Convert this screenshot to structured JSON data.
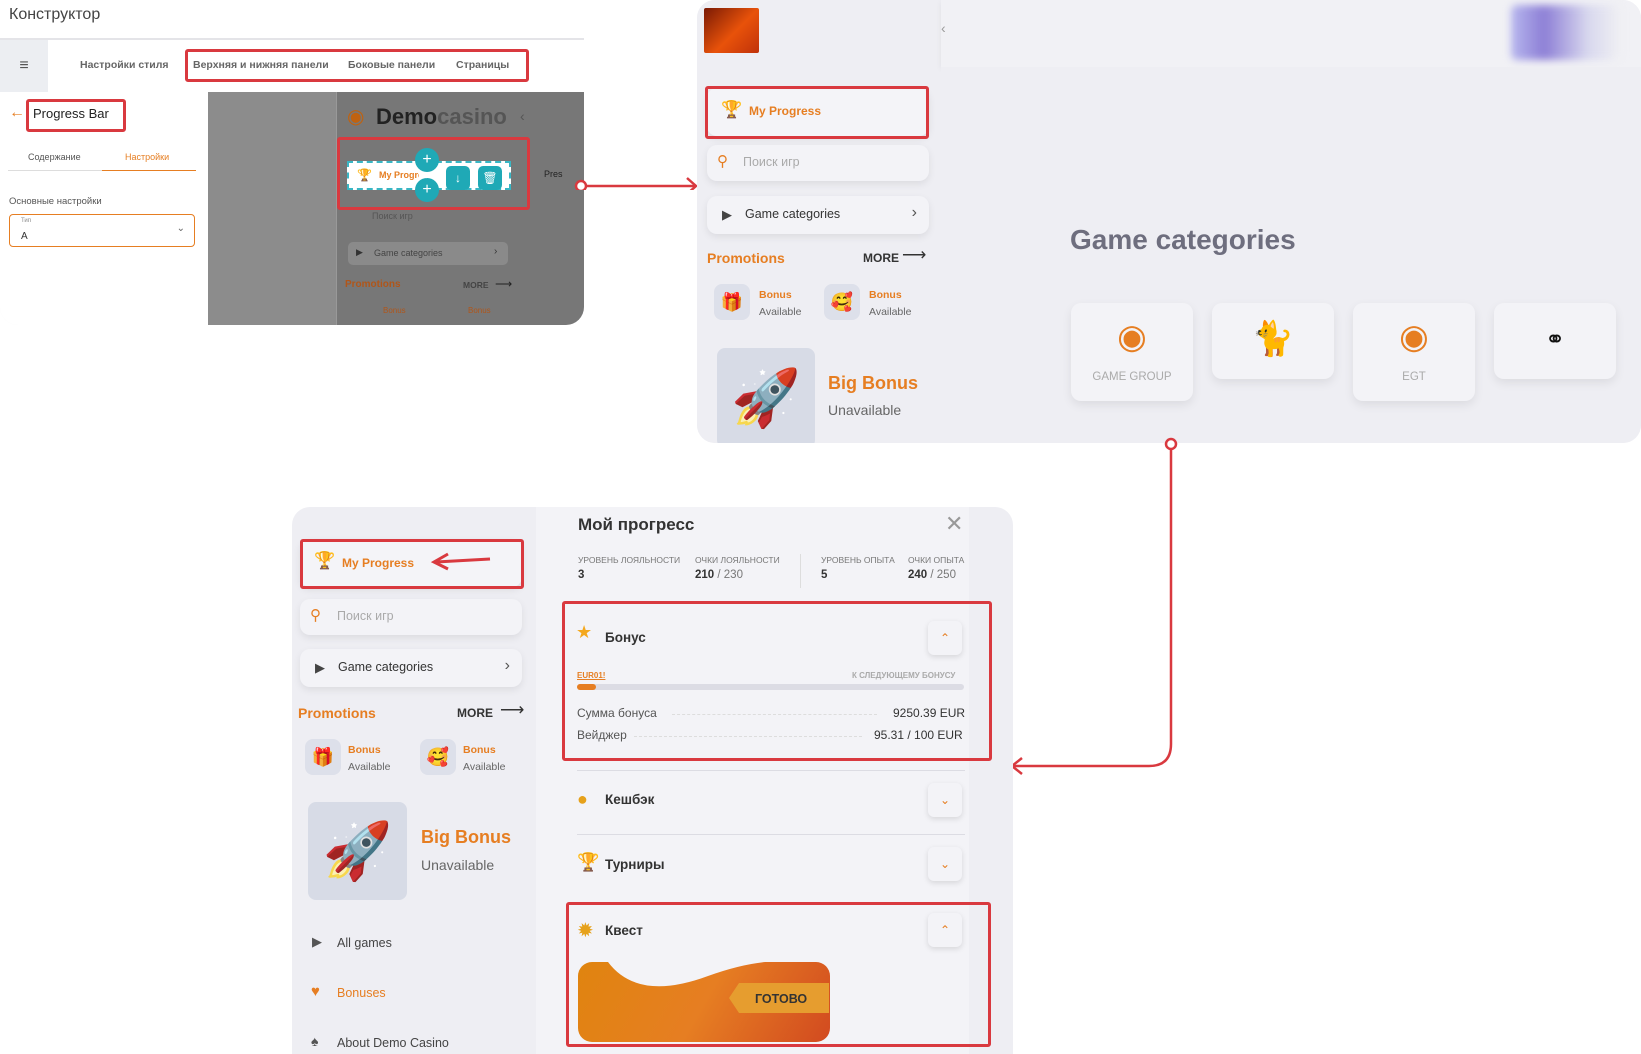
{
  "panel1": {
    "app_title": "Конструктор",
    "menu_icon": "menu-icon",
    "tabs": [
      "Настройки стиля",
      "Верхняя и нижняя панели",
      "Боковые панели",
      "Страницы"
    ],
    "section_title": "Progress Bar",
    "subtabs": [
      "Содержание",
      "Настройки"
    ],
    "settings_label": "Основные настройки",
    "type_label": "Тип",
    "type_value": "A",
    "preview": {
      "logo_demo": "Demo",
      "logo_casino": "casino",
      "my_progress": "My Progress",
      "search": "Поиск игр",
      "game_categories": "Game categories",
      "promotions": "Promotions",
      "more": "MORE",
      "bonus": "Bonus",
      "broken_img": "Pres"
    }
  },
  "panel2": {
    "my_progress": "My Progress",
    "search_placeholder": "Поиск игр",
    "game_categories": "Game categories",
    "promotions": "Promotions",
    "more": "MORE",
    "bonus_title": "Bonus",
    "bonus_status": "Available",
    "big_bonus": "Big Bonus",
    "big_bonus_status": "Unavailable",
    "heading": "Game categories",
    "provider_cards": [
      "GAME GROUP",
      "",
      "EGT",
      ""
    ]
  },
  "panel3": {
    "my_progress": "My Progress",
    "search_placeholder": "Поиск игр",
    "game_categories": "Game categories",
    "promotions": "Promotions",
    "more": "MORE",
    "bonus_title": "Bonus",
    "bonus_status": "Available",
    "big_bonus": "Big Bonus",
    "big_bonus_status": "Unavailable",
    "nav": [
      "All games",
      "Bonuses",
      "About Demo Casino"
    ],
    "modal": {
      "title": "Мой прогресс",
      "stats": [
        {
          "label": "Уровень лояльности",
          "value": "3",
          "max": ""
        },
        {
          "label": "Очки лояльности",
          "value": "210",
          "max": "/ 230"
        },
        {
          "label": "Уровень опыта",
          "value": "5",
          "max": ""
        },
        {
          "label": "Очки опыта",
          "value": "240",
          "max": "/ 250"
        }
      ],
      "bonus_section": {
        "title": "Бонус",
        "code": "EUR01!",
        "next_label": "К следующему бонусу",
        "progress": 0.05,
        "sum_label": "Сумма бонуса",
        "sum_value": "9250.39 EUR",
        "wager_label": "Вейджер",
        "wager_value": "95.31 / 100 EUR"
      },
      "cashback": "Кешбэк",
      "tournaments": "Турниры",
      "quest": "Квест",
      "quest_ready": "ГОТОВО"
    }
  },
  "colors": {
    "accent": "#e67e22",
    "highlight": "#d9393f",
    "teal": "#1fa9b6"
  }
}
